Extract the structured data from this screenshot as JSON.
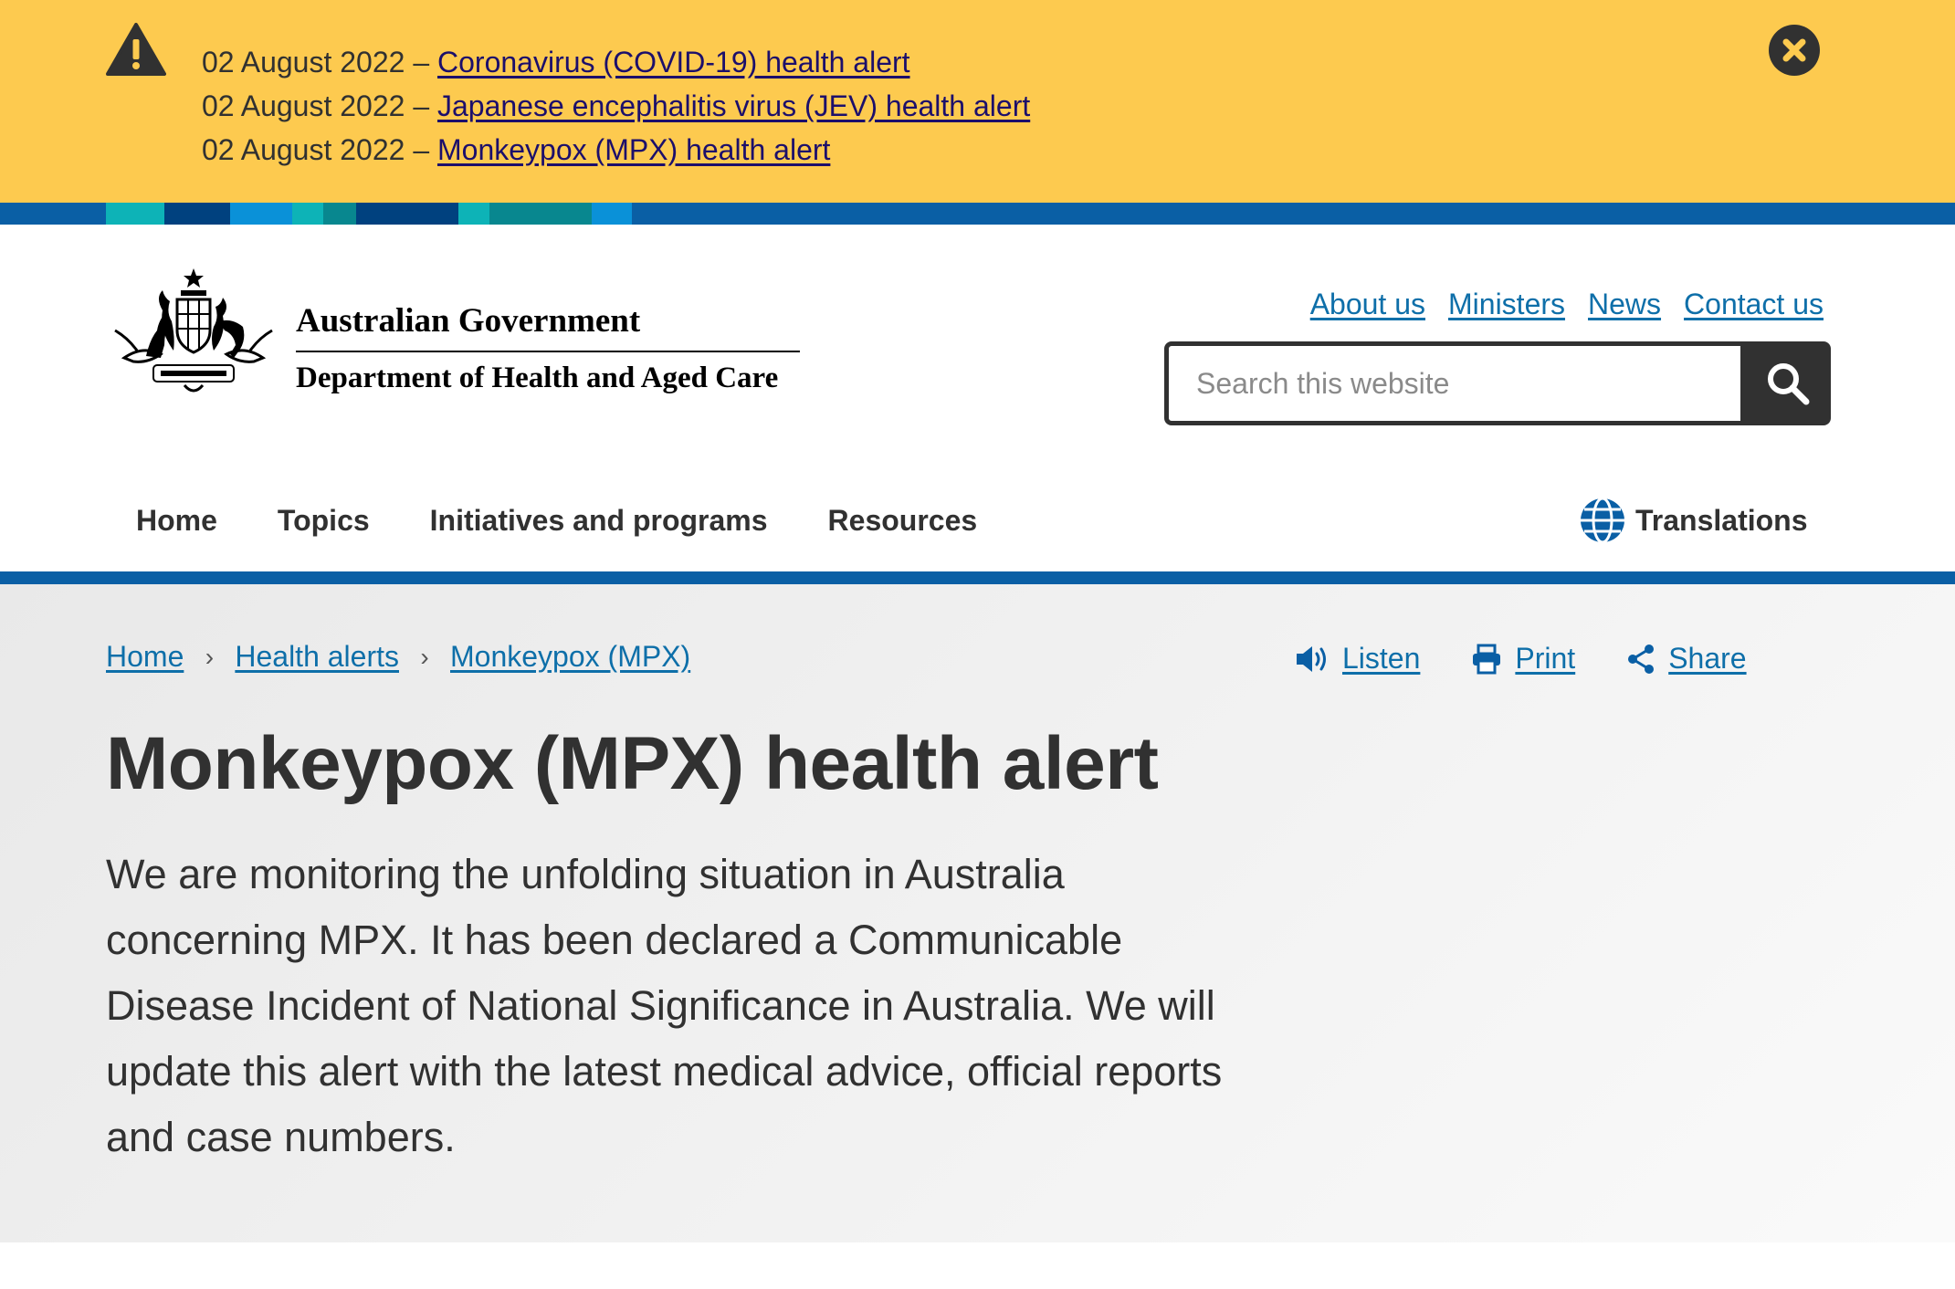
{
  "alerts": [
    {
      "date": "02 August 2022 – ",
      "link": "Coronavirus (COVID-19) health alert"
    },
    {
      "date": "02 August 2022 – ",
      "link": "Japanese encephalitis virus (JEV) health alert"
    },
    {
      "date": "02 August 2022 – ",
      "link": "Monkeypox (MPX) health alert"
    }
  ],
  "header": {
    "org_name": "Australian Government",
    "department": "Department of Health and Aged Care",
    "utility_links": [
      "About us",
      "Ministers",
      "News",
      "Contact us"
    ],
    "search_placeholder": "Search this website"
  },
  "nav": {
    "items": [
      "Home",
      "Topics",
      "Initiatives and programs",
      "Resources"
    ],
    "translations": "Translations"
  },
  "breadcrumb": [
    "Home",
    "Health alerts",
    "Monkeypox (MPX)"
  ],
  "actions": {
    "listen": "Listen",
    "print": "Print",
    "share": "Share"
  },
  "page": {
    "title": "Monkeypox (MPX) health alert",
    "intro": "We are monitoring the unfolding situation in Australia concerning MPX. It has been declared a Communicable Disease Incident of National Significance in Australia. We will update this alert with the latest medical advice, official reports and case numbers."
  },
  "colors": {
    "alert_bg": "#fdca4f",
    "link": "#0e6fa9",
    "brand_blue": "#0a5fa5",
    "text": "#313131"
  }
}
